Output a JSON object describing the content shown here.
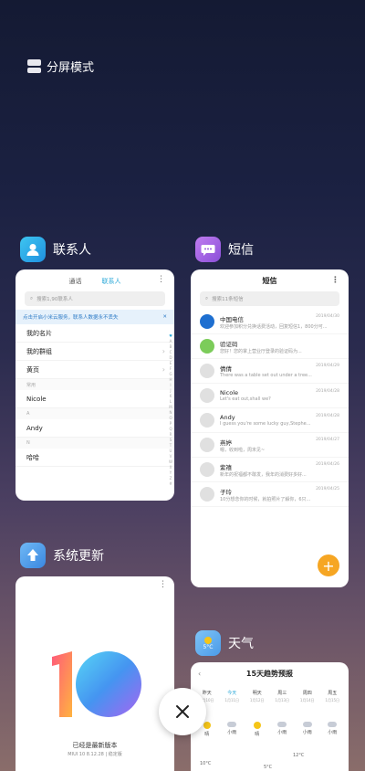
{
  "split_mode": {
    "label": "分屏模式"
  },
  "contacts": {
    "title": "联系人",
    "tabs": [
      "通话",
      "联系人"
    ],
    "search_placeholder": "搜索1,90联系人",
    "banner": "点击开启小米云服务，联系人数据永不丢失",
    "rows": [
      {
        "label": "我的名片",
        "type": "row"
      },
      {
        "label": "我的群组",
        "type": "row",
        "chev": true
      },
      {
        "label": "黄页",
        "type": "row",
        "chev": true
      },
      {
        "label": "常用",
        "type": "section"
      },
      {
        "label": "Nicole",
        "type": "row"
      },
      {
        "label": "A",
        "type": "section"
      },
      {
        "label": "Andy",
        "type": "row"
      },
      {
        "label": "N",
        "type": "section"
      },
      {
        "label": "哈哈",
        "type": "row"
      }
    ],
    "alphabet": [
      "♥",
      "A",
      "B",
      "C",
      "D",
      "E",
      "F",
      "G",
      "H",
      "I",
      "J",
      "K",
      "L",
      "M",
      "N",
      "O",
      "P",
      "Q",
      "R",
      "S",
      "T",
      "U",
      "V",
      "W",
      "X",
      "Y",
      "Z",
      "#"
    ]
  },
  "sms": {
    "title": "短信",
    "header": "短信",
    "search_placeholder": "搜索11条短信",
    "messages": [
      {
        "name": "中国电信",
        "time": "2019/04/30",
        "preview": "欢迎参加积分兑换话费活动，回复短信1，800分可..."
      },
      {
        "name": "验证码",
        "time": "",
        "preview": "您好！您的掌上营业厅登录的验证码为..."
      },
      {
        "name": "倩倩",
        "time": "2019/04/29",
        "preview": "There was a table set out under a tree..."
      },
      {
        "name": "Nicole",
        "time": "2019/04/28",
        "preview": "Let's eat out,shall we?"
      },
      {
        "name": "Andy",
        "time": "2019/04/28",
        "preview": "I guess you're some lucky guy,Stephe..."
      },
      {
        "name": "燕婷",
        "time": "2019/04/27",
        "preview": "嗯，收到啦，周末见~"
      },
      {
        "name": "紫禧",
        "time": "2019/04/26",
        "preview": "新年的祝福都不敢发，我年的消费好多好..."
      },
      {
        "name": "子玲",
        "time": "2019/04/25",
        "preview": "10分想念你的时候，就拍照片了解你，6只..."
      }
    ],
    "fab": "+"
  },
  "update": {
    "title": "系统更新",
    "status": "已经是最新版本",
    "version": "MIUI 10 8.12.28 | 稳定版"
  },
  "weather": {
    "title": "天气",
    "icon_temp": "5°C",
    "header": "15天趋势预报",
    "days": [
      {
        "name": "昨天",
        "date": "1月10日"
      },
      {
        "name": "今天",
        "date": "1月11日"
      },
      {
        "name": "明天",
        "date": "1月12日"
      },
      {
        "name": "周三",
        "date": "1月13日"
      },
      {
        "name": "周四",
        "date": "1月14日"
      },
      {
        "name": "周五",
        "date": "1月15日"
      }
    ],
    "conditions": [
      "晴",
      "小雨",
      "晴",
      "小雨",
      "小雨",
      "小雨"
    ],
    "temps": [
      "10°C",
      "5°C",
      "12°C"
    ]
  },
  "colors": {
    "accent": "#2aa8d8",
    "fab": "#f6a623"
  }
}
